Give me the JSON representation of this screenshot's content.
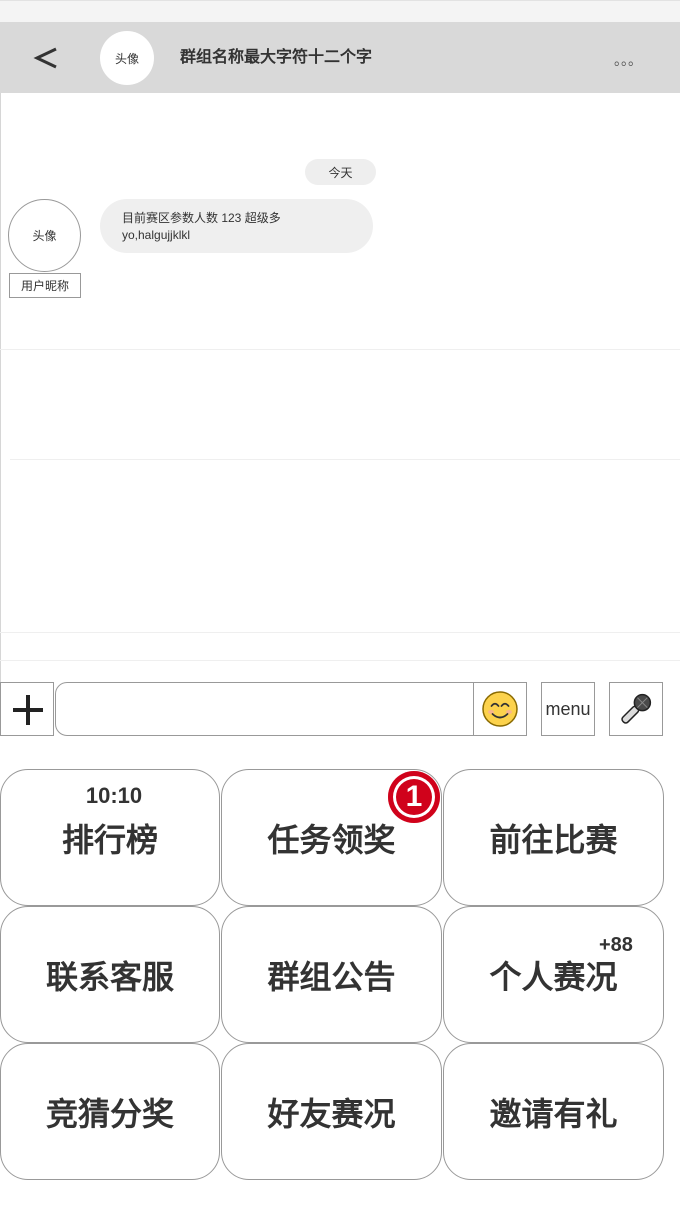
{
  "header": {
    "back_icon": "chevron-left-icon",
    "avatar_label": "头像",
    "title": "群组名称最大字符十二个字",
    "more_label": "。。。"
  },
  "chat": {
    "date_label": "今天",
    "messages": [
      {
        "avatar_label": "头像",
        "nickname": "用户昵称",
        "lines": [
          "目前赛区参数人数 123 超级多",
          "yo,halgujjklkl"
        ]
      }
    ]
  },
  "input_bar": {
    "plus_icon": "plus-icon",
    "input_value": "",
    "emoji_icon": "smiley-face-icon",
    "menu_label": "menu",
    "mic_icon": "microphone-icon"
  },
  "function_grid": {
    "buttons": [
      {
        "label": "排行榜",
        "top_text": "10:10"
      },
      {
        "label": "任务领奖",
        "badge": "1"
      },
      {
        "label": "前往比赛"
      },
      {
        "label": "联系客服"
      },
      {
        "label": "群组公告"
      },
      {
        "label": "个人赛况",
        "corner_text": "+88"
      },
      {
        "label": "竞猜分奖"
      },
      {
        "label": "好友赛况"
      },
      {
        "label": "邀请有礼"
      }
    ]
  },
  "colors": {
    "header_bg": "#d9d9d9",
    "bubble_bg": "#efefef",
    "badge": "#d0021b",
    "border": "#999999"
  }
}
